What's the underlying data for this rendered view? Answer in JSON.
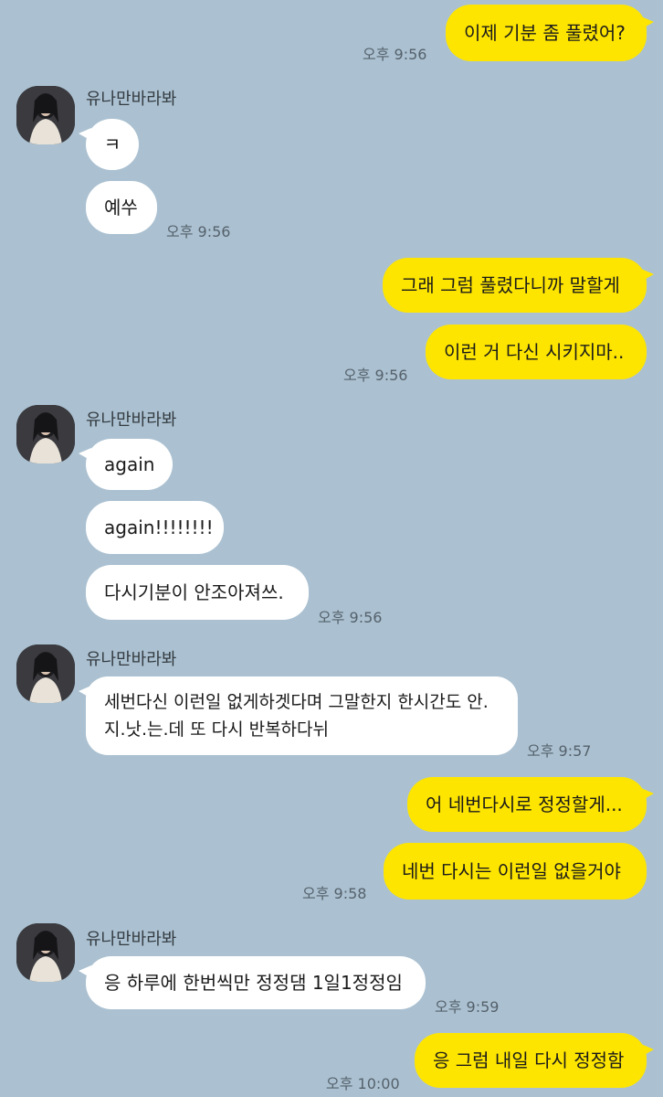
{
  "chat": {
    "partner_name": "유나만바라봐",
    "messages": [
      {
        "id": "m1",
        "from": "me",
        "text": "이제 기분 좀 풀렸어?",
        "time": "오후 9:56"
      },
      {
        "id": "m2",
        "from": "them",
        "text": "ㅋ",
        "time": ""
      },
      {
        "id": "m3",
        "from": "them",
        "text": "예쑤",
        "time": "오후 9:56"
      },
      {
        "id": "m4",
        "from": "me",
        "text": "그래 그럼 풀렸다니까 말할게",
        "time": ""
      },
      {
        "id": "m5",
        "from": "me",
        "text": "이런 거 다신 시키지마..",
        "time": "오후 9:56"
      },
      {
        "id": "m6",
        "from": "them",
        "text": "again",
        "time": ""
      },
      {
        "id": "m7",
        "from": "them",
        "text": "again!!!!!!!!",
        "time": ""
      },
      {
        "id": "m8",
        "from": "them",
        "text": "다시기분이 안조아져쓰.",
        "time": "오후 9:56"
      },
      {
        "id": "m9",
        "from": "them",
        "text": "세번다신 이런일 없게하겟다며 그말한지 한시간도 안.지.낫.는.데 또 다시 반복하다뉘",
        "time": "오후 9:57"
      },
      {
        "id": "m10",
        "from": "me",
        "text": "어 네번다시로 정정할게...",
        "time": ""
      },
      {
        "id": "m11",
        "from": "me",
        "text": "네번 다시는 이런일 없을거야",
        "time": "오후 9:58"
      },
      {
        "id": "m12",
        "from": "them",
        "text": "응 하루에 한번씩만 정정댐 1일1정정임",
        "time": "오후 9:59"
      },
      {
        "id": "m13",
        "from": "me",
        "text": "응 그럼 내일 다시 정정함",
        "time": "오후 10:00"
      }
    ]
  },
  "colors": {
    "background": "#abc1d1",
    "my_bubble": "#fee500",
    "their_bubble": "#ffffff",
    "time_text": "#55616b"
  },
  "icons": {
    "avatar": "profile-photo"
  }
}
